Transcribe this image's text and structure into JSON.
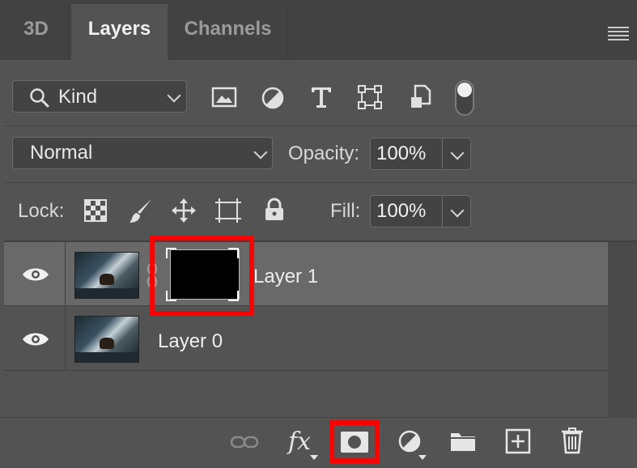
{
  "tabs": [
    {
      "label": "3D",
      "active": false
    },
    {
      "label": "Layers",
      "active": true
    },
    {
      "label": "Channels",
      "active": false
    }
  ],
  "filter": {
    "kind_label": "Kind",
    "icons": [
      "image-filter-icon",
      "adjustment-filter-icon",
      "type-filter-icon",
      "shape-filter-icon",
      "smart-object-filter-icon",
      "filter-toggle-icon"
    ]
  },
  "blend": {
    "mode": "Normal",
    "opacity_label": "Opacity:",
    "opacity_value": "100%"
  },
  "lock": {
    "label": "Lock:",
    "icons": [
      "lock-transparent-pixels-icon",
      "lock-image-pixels-icon",
      "lock-position-icon",
      "lock-artboard-icon",
      "lock-all-icon"
    ],
    "fill_label": "Fill:",
    "fill_value": "100%"
  },
  "layers": [
    {
      "name": "Layer 1",
      "selected": true,
      "has_mask": true,
      "visible": true
    },
    {
      "name": "Layer 0",
      "selected": false,
      "has_mask": false,
      "visible": true
    }
  ],
  "bottom_icons": [
    "link-layers-icon",
    "fx-icon",
    "add-mask-icon",
    "adjustment-layer-icon",
    "group-folder-icon",
    "new-layer-icon",
    "delete-icon"
  ],
  "colors": {
    "panel_bg": "#535353",
    "tab_bar_bg": "#424242",
    "selected_row": "#696969",
    "highlight": "#ff0000"
  }
}
